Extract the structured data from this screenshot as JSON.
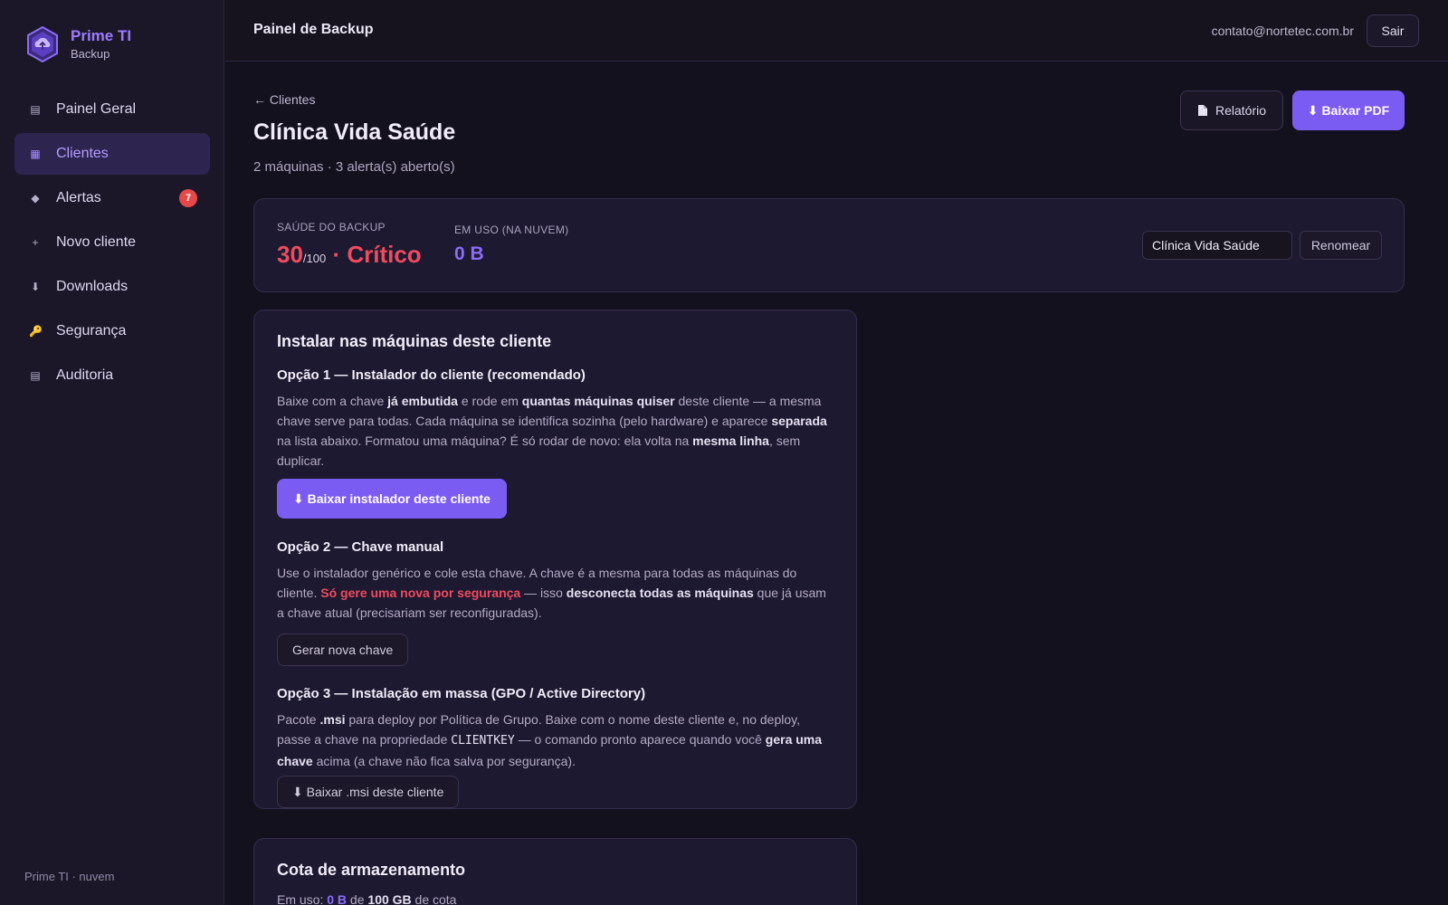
{
  "brand": {
    "name": "Prime TI",
    "sub": "Backup"
  },
  "sidebar": {
    "items": [
      {
        "label": "Painel Geral",
        "icon": "▤"
      },
      {
        "label": "Clientes",
        "icon": "▦"
      },
      {
        "label": "Alertas",
        "icon": "◆",
        "badge": "7"
      },
      {
        "label": "Novo cliente",
        "icon": "+"
      },
      {
        "label": "Downloads",
        "icon": "⬇"
      },
      {
        "label": "Segurança",
        "icon": "🔑"
      },
      {
        "label": "Auditoria",
        "icon": "▤"
      }
    ],
    "footer": "Prime TI · nuvem"
  },
  "header": {
    "title": "Painel de Backup",
    "email": "contato@nortetec.com.br",
    "logout": "Sair"
  },
  "page": {
    "back": "← Clientes",
    "title": "Clínica Vida Saúde",
    "subtitle": "2 máquinas · 3 alerta(s) aberto(s)",
    "report_btn": "Relatório",
    "pdf_btn": "⬇ Baixar PDF"
  },
  "health": {
    "label": "SAÚDE DO BACKUP",
    "score": "30",
    "max": "/100",
    "status": " · Crítico",
    "usage_label": "EM USO (NA NUVEM)",
    "usage": "0 B",
    "name_value": "Clínica Vida Saúde",
    "rename_btn": "Renomear"
  },
  "install": {
    "title": "Instalar nas máquinas deste cliente",
    "opt1_title": "Opção 1 — Instalador do cliente (recomendado)",
    "opt1_a": "Baixe com a chave ",
    "opt1_b": "já embutida",
    "opt1_c": " e rode em ",
    "opt1_d": "quantas máquinas quiser",
    "opt1_e": " deste cliente — a mesma chave serve para todas. Cada máquina se identifica sozinha (pelo hardware) e aparece ",
    "opt1_f": "separada",
    "opt1_g": " na lista abaixo. Formatou uma máquina? É só rodar de novo: ela volta na ",
    "opt1_h": "mesma linha",
    "opt1_i": ", sem duplicar.",
    "opt1_btn": "⬇ Baixar instalador deste cliente",
    "opt2_title": "Opção 2 — Chave manual",
    "opt2_a": "Use o instalador genérico e cole esta chave. A chave é a mesma para todas as máquinas do cliente. ",
    "opt2_b": "Só gere uma nova por segurança",
    "opt2_c": " — isso ",
    "opt2_d": "desconecta todas as máquinas",
    "opt2_e": " que já usam a chave atual (precisariam ser reconfiguradas).",
    "opt2_btn": "Gerar nova chave",
    "opt3_title": "Opção 3 — Instalação em massa (GPO / Active Directory)",
    "opt3_a": "Pacote ",
    "opt3_b": ".msi",
    "opt3_c": " para deploy por Política de Grupo. Baixe com o nome deste cliente e, no deploy, passe a chave na propriedade ",
    "opt3_d": "CLIENTKEY",
    "opt3_e": " — o comando pronto aparece quando você ",
    "opt3_f": "gera uma chave",
    "opt3_g": " acima (a chave não fica salva por segurança).",
    "opt3_btn": "⬇ Baixar .msi deste cliente"
  },
  "quota": {
    "title": "Cota de armazenamento",
    "a": "Em uso: ",
    "used": "0 B",
    "b": " de ",
    "total": "100 GB",
    "c": " de cota"
  },
  "colors": {
    "accent": "#7b5cf2",
    "critical": "#ef4b5e",
    "badge": "#e44848"
  }
}
